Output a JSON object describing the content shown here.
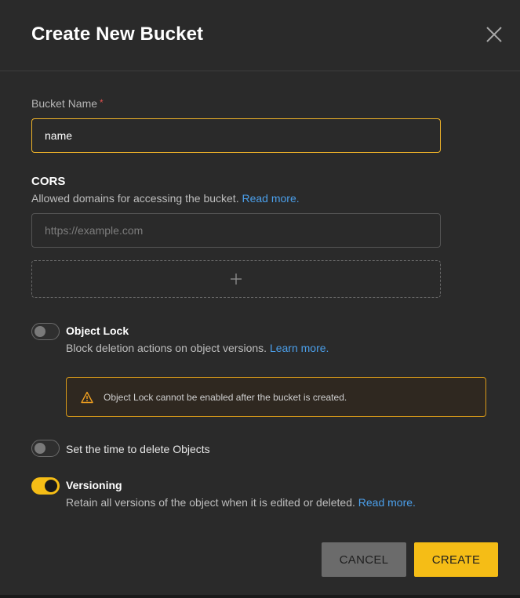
{
  "dialog": {
    "title": "Create New Bucket"
  },
  "bucket_name": {
    "label": "Bucket Name",
    "required_mark": "*",
    "value": "name"
  },
  "cors": {
    "title": "CORS",
    "description": "Allowed domains for accessing the bucket.",
    "link": "Read more.",
    "placeholder": "https://example.com"
  },
  "object_lock": {
    "title": "Object Lock",
    "description": "Block deletion actions on object versions.",
    "link": "Learn more.",
    "enabled": false,
    "warning": "Object Lock cannot be enabled after the bucket is created."
  },
  "expiration": {
    "title": "Set the time to delete Objects",
    "enabled": false
  },
  "versioning": {
    "title": "Versioning",
    "description": "Retain all versions of the object when it is edited or deleted.",
    "link": "Read more.",
    "enabled": true
  },
  "actions": {
    "cancel_label": "CANCEL",
    "create_label": "CREATE"
  },
  "colors": {
    "accent": "#f5bd16",
    "link": "#4b9fea",
    "warning_border": "#d89a1a",
    "required": "#e0504e"
  },
  "icons": {
    "close": "close-icon",
    "add": "plus-icon",
    "warning": "warning-icon"
  }
}
